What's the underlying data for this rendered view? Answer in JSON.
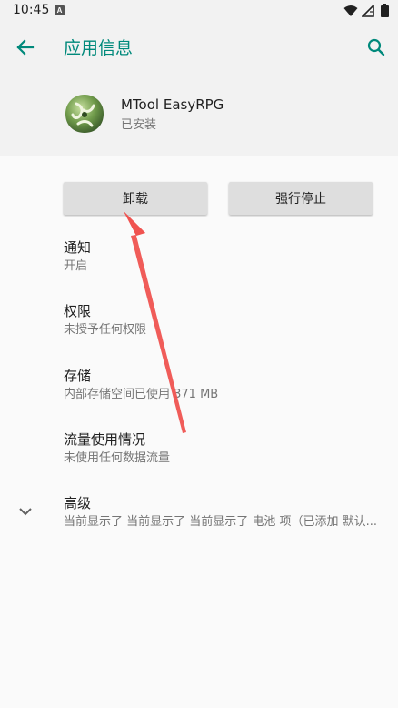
{
  "status_bar": {
    "time": "10:45",
    "notification_badge": "A",
    "icons": [
      "wifi-icon",
      "signal-icon",
      "battery-icon"
    ]
  },
  "toolbar": {
    "title": "应用信息",
    "back_icon": "arrow-left-icon",
    "search_icon": "search-icon"
  },
  "app": {
    "name": "MTool EasyRPG",
    "status": "已安装"
  },
  "buttons": {
    "uninstall": "卸载",
    "force_stop": "强行停止"
  },
  "items": [
    {
      "title": "通知",
      "subtitle": "开启"
    },
    {
      "title": "权限",
      "subtitle": "未授予任何权限"
    },
    {
      "title": "存储",
      "subtitle": "内部存储空间已使用 371 MB"
    },
    {
      "title": "流量使用情况",
      "subtitle": "未使用任何数据流量"
    },
    {
      "title": "高级",
      "subtitle": "当前显示了 当前显示了 当前显示了 电池 项（已添加 默认..."
    }
  ],
  "colors": {
    "accent": "#00897b",
    "annotation_arrow": "#ef5350",
    "header_bg": "#f2f2f2",
    "page_bg": "#fafafa"
  }
}
